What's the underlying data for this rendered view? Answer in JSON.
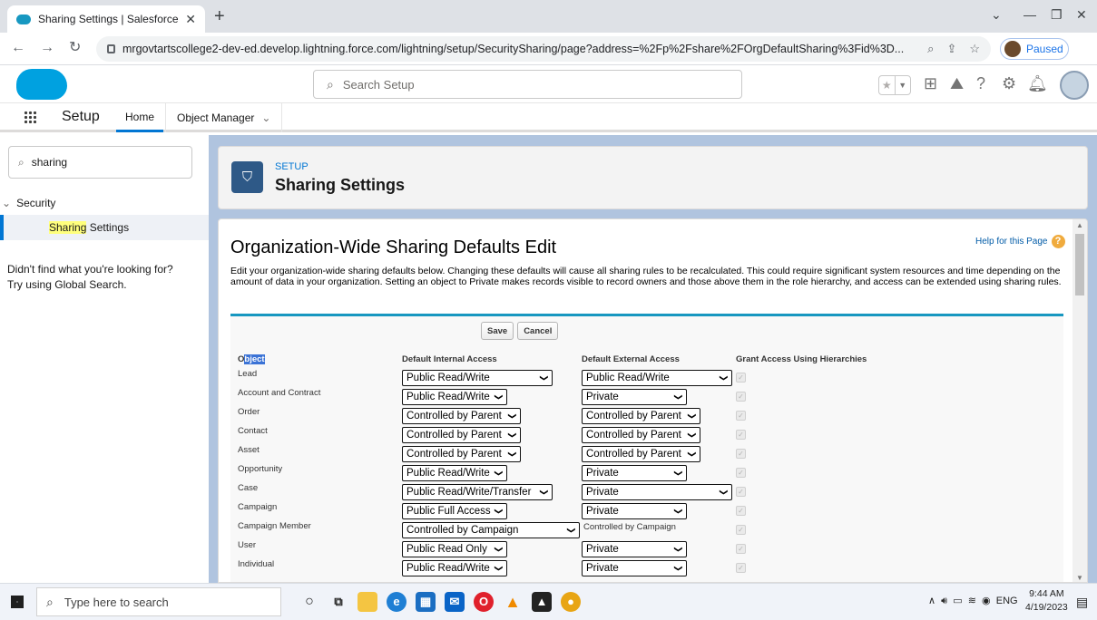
{
  "browser": {
    "tab_title": "Sharing Settings | Salesforce",
    "url": "mrgovtartscollege2-dev-ed.develop.lightning.force.com/lightning/setup/SecuritySharing/page?address=%2Fp%2Fshare%2FOrgDefaultSharing%3Fid%3D...",
    "profile_label": "Paused"
  },
  "header": {
    "search_placeholder": "Search Setup"
  },
  "setup_nav": {
    "app_name": "Setup",
    "home_tab": "Home",
    "object_manager_tab": "Object Manager"
  },
  "left_panel": {
    "quick_find_value": "sharing",
    "section_label": "Security",
    "nav_item_highlight": "Sharing",
    "nav_item_rest": " Settings",
    "not_found_line1": "Didn't find what you're looking for?",
    "not_found_line2": "Try using Global Search."
  },
  "title_card": {
    "eyebrow": "SETUP",
    "title": "Sharing Settings"
  },
  "content": {
    "help_link": "Help for this Page",
    "heading": "Organization-Wide Sharing Defaults Edit",
    "description": "Edit your organization-wide sharing defaults below. Changing these defaults will cause all sharing rules to be recalculated. This could require significant system resources and time depending on the amount of data in your organization. Setting an object to Private makes records visible to record owners and those above them in the role hierarchy, and access can be extended using sharing rules.",
    "save_label": "Save",
    "cancel_label": "Cancel",
    "columns": {
      "object_prefix": "O",
      "object_selected": "bject",
      "internal": "Default Internal Access",
      "external": "Default External Access",
      "hierarchy": "Grant Access Using Hierarchies"
    },
    "rows": [
      {
        "object": "Lead",
        "internal": "Public Read/Write",
        "external": "Public Read/Write"
      },
      {
        "object": "Account and Contract",
        "internal": "Public Read/Write",
        "external": "Private"
      },
      {
        "object": "Order",
        "internal": "Controlled by Parent",
        "external": "Controlled by Parent"
      },
      {
        "object": "Contact",
        "internal": "Controlled by Parent",
        "external": "Controlled by Parent"
      },
      {
        "object": "Asset",
        "internal": "Controlled by Parent",
        "external": "Controlled by Parent"
      },
      {
        "object": "Opportunity",
        "internal": "Public Read/Write",
        "external": "Private"
      },
      {
        "object": "Case",
        "internal": "Public Read/Write/Transfer",
        "external": "Private"
      },
      {
        "object": "Campaign",
        "internal": "Public Full Access",
        "external": "Private"
      },
      {
        "object": "Campaign Member",
        "internal": "Controlled by Campaign",
        "external": "Controlled by Campaign"
      },
      {
        "object": "User",
        "internal": "Public Read Only",
        "external": "Private"
      },
      {
        "object": "Individual",
        "internal": "Public Read/Write",
        "external": "Private"
      }
    ]
  },
  "taskbar": {
    "search_placeholder": "Type here to search",
    "lang": "ENG",
    "time": "9:44 AM",
    "date": "4/19/2023"
  }
}
